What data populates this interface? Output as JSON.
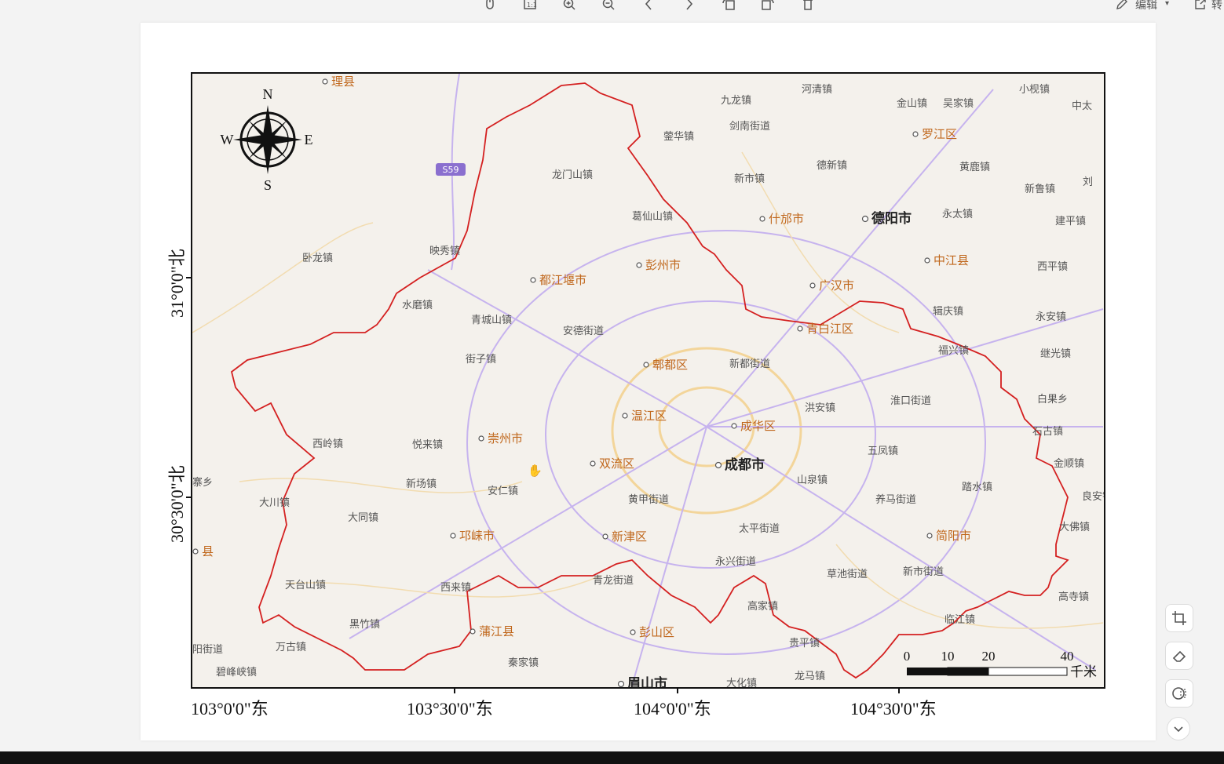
{
  "toolbar": {
    "edit_label": "编辑",
    "export_label": "转",
    "icons": [
      "mouse-icon",
      "actual-size-icon",
      "zoom-in-icon",
      "zoom-out-icon",
      "prev-icon",
      "next-icon",
      "rotate-left-icon",
      "rotate-right-icon",
      "delete-icon"
    ]
  },
  "map": {
    "compass": {
      "n": "N",
      "s": "S",
      "e": "E",
      "w": "W"
    },
    "lat_labels": [
      "31°0'0\"北",
      "30°30'0\"北"
    ],
    "lon_labels": [
      "103°0'0\"东",
      "103°30'0\"东",
      "104°0'0\"东",
      "104°30'0\"东"
    ],
    "scale_bar": {
      "ticks": [
        "0",
        "10",
        "20",
        "40"
      ],
      "unit": "千米"
    },
    "highway_shield": "S59",
    "places": [
      {
        "name": "理县",
        "kind": "city"
      },
      {
        "name": "河清镇",
        "kind": "town"
      },
      {
        "name": "九龙镇",
        "kind": "town"
      },
      {
        "name": "金山镇",
        "kind": "town"
      },
      {
        "name": "吴家镇",
        "kind": "town"
      },
      {
        "name": "小枧镇",
        "kind": "town"
      },
      {
        "name": "中太",
        "kind": "town"
      },
      {
        "name": "蓥华镇",
        "kind": "town"
      },
      {
        "name": "剑南街道",
        "kind": "town"
      },
      {
        "name": "罗江区",
        "kind": "city"
      },
      {
        "name": "龙门山镇",
        "kind": "town"
      },
      {
        "name": "德新镇",
        "kind": "town"
      },
      {
        "name": "黄鹿镇",
        "kind": "town"
      },
      {
        "name": "新市镇",
        "kind": "town"
      },
      {
        "name": "新鲁镇",
        "kind": "town"
      },
      {
        "name": "刘",
        "kind": "town"
      },
      {
        "name": "永太镇",
        "kind": "town"
      },
      {
        "name": "建平镇",
        "kind": "town"
      },
      {
        "name": "葛仙山镇",
        "kind": "town"
      },
      {
        "name": "什邡市",
        "kind": "city"
      },
      {
        "name": "德阳市",
        "kind": "capital"
      },
      {
        "name": "卧龙镇",
        "kind": "town"
      },
      {
        "name": "映秀镇",
        "kind": "town"
      },
      {
        "name": "中江县",
        "kind": "city"
      },
      {
        "name": "西平镇",
        "kind": "town"
      },
      {
        "name": "彭州市",
        "kind": "city"
      },
      {
        "name": "都江堰市",
        "kind": "city"
      },
      {
        "name": "广汉市",
        "kind": "city"
      },
      {
        "name": "水磨镇",
        "kind": "town"
      },
      {
        "name": "辑庆镇",
        "kind": "town"
      },
      {
        "name": "永安镇",
        "kind": "town"
      },
      {
        "name": "青城山镇",
        "kind": "town"
      },
      {
        "name": "青白江区",
        "kind": "city"
      },
      {
        "name": "安德街道",
        "kind": "town"
      },
      {
        "name": "福兴镇",
        "kind": "town"
      },
      {
        "name": "继光镇",
        "kind": "town"
      },
      {
        "name": "街子镇",
        "kind": "town"
      },
      {
        "name": "郫都区",
        "kind": "city"
      },
      {
        "name": "新都街道",
        "kind": "town"
      },
      {
        "name": "淮口街道",
        "kind": "town"
      },
      {
        "name": "白果乡",
        "kind": "town"
      },
      {
        "name": "洪安镇",
        "kind": "town"
      },
      {
        "name": "温江区",
        "kind": "city"
      },
      {
        "name": "成华区",
        "kind": "city"
      },
      {
        "name": "石古镇",
        "kind": "town"
      },
      {
        "name": "西岭镇",
        "kind": "town"
      },
      {
        "name": "悦来镇",
        "kind": "town"
      },
      {
        "name": "崇州市",
        "kind": "city"
      },
      {
        "name": "五凤镇",
        "kind": "town"
      },
      {
        "name": "双流区",
        "kind": "city"
      },
      {
        "name": "成都市",
        "kind": "capital"
      },
      {
        "name": "金顺镇",
        "kind": "town"
      },
      {
        "name": "寨乡",
        "kind": "town"
      },
      {
        "name": "新场镇",
        "kind": "town"
      },
      {
        "name": "山泉镇",
        "kind": "town"
      },
      {
        "name": "踏水镇",
        "kind": "town"
      },
      {
        "name": "大川镇",
        "kind": "town"
      },
      {
        "name": "安仁镇",
        "kind": "town"
      },
      {
        "name": "黄甲街道",
        "kind": "town"
      },
      {
        "name": "养马街道",
        "kind": "town"
      },
      {
        "name": "良安镇",
        "kind": "town"
      },
      {
        "name": "大同镇",
        "kind": "town"
      },
      {
        "name": "太平街道",
        "kind": "town"
      },
      {
        "name": "大佛镇",
        "kind": "town"
      },
      {
        "name": "邛崃市",
        "kind": "city"
      },
      {
        "name": "新津区",
        "kind": "city"
      },
      {
        "name": "简阳市",
        "kind": "city"
      },
      {
        "name": "县",
        "kind": "city"
      },
      {
        "name": "永兴街道",
        "kind": "town"
      },
      {
        "name": "新市街道",
        "kind": "town"
      },
      {
        "name": "天台山镇",
        "kind": "town"
      },
      {
        "name": "西来镇",
        "kind": "town"
      },
      {
        "name": "青龙街道",
        "kind": "town"
      },
      {
        "name": "草池街道",
        "kind": "town"
      },
      {
        "name": "高寺镇",
        "kind": "town"
      },
      {
        "name": "高家镇",
        "kind": "town"
      },
      {
        "name": "黑竹镇",
        "kind": "town"
      },
      {
        "name": "临江镇",
        "kind": "town"
      },
      {
        "name": "蒲江县",
        "kind": "city"
      },
      {
        "name": "彭山区",
        "kind": "city"
      },
      {
        "name": "阳街道",
        "kind": "town"
      },
      {
        "name": "万古镇",
        "kind": "town"
      },
      {
        "name": "贵平镇",
        "kind": "town"
      },
      {
        "name": "秦家镇",
        "kind": "town"
      },
      {
        "name": "碧峰峡镇",
        "kind": "town"
      },
      {
        "name": "龙马镇",
        "kind": "town"
      },
      {
        "name": "眉山市",
        "kind": "capital"
      },
      {
        "name": "大化镇",
        "kind": "town"
      }
    ]
  },
  "colors": {
    "boundary": "#d42020",
    "road_major": "#c9b6f0",
    "road_minor": "#f5d9a8",
    "land": "#f4f1ec"
  }
}
